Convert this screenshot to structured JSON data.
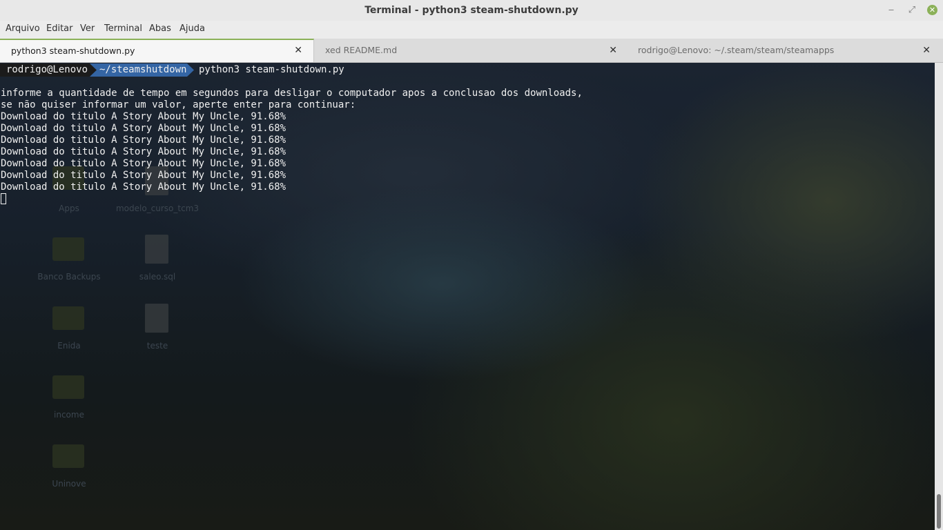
{
  "window": {
    "title": "Terminal - python3 steam-shutdown.py",
    "minimize_glyph": "‒",
    "maximize_glyph": "⤢",
    "close_glyph": "✕"
  },
  "menu": {
    "items": [
      "Arquivo",
      "Editar",
      "Ver",
      "Terminal",
      "Abas",
      "Ajuda"
    ]
  },
  "tabs": [
    {
      "label": "python3 steam-shutdown.py",
      "close": "✕"
    },
    {
      "label": "xed README.md",
      "close": "✕"
    },
    {
      "label": "rodrigo@Lenovo: ~/.steam/steam/steamapps",
      "close": "✕"
    }
  ],
  "prompt": {
    "user_host": "rodrigo@Lenovo",
    "path": "~/steamshutdown",
    "command": "python3 steam-shutdown.py"
  },
  "output": [
    "informe a quantidade de tempo em segundos para desligar o computador apos a conclusao dos downloads,",
    "se não quiser informar um valor, aperte enter para continuar:",
    "Download do titulo A Story About My Uncle, 91.68%",
    "Download do titulo A Story About My Uncle, 91.68%",
    "Download do titulo A Story About My Uncle, 91.68%",
    "Download do titulo A Story About My Uncle, 91.68%",
    "Download do titulo A Story About My Uncle, 91.68%",
    "Download do titulo A Story About My Uncle, 91.68%",
    "Download do titulo A Story About My Uncle, 91.68%"
  ],
  "desktop": {
    "icons": [
      "Apps",
      "modelo_curso_tcm3",
      "Banco Backups",
      "saleo.sql",
      "Enida",
      "teste",
      "income",
      "Uninove"
    ]
  },
  "colors": {
    "accent": "#8bb158",
    "prompt_user_bg": "#1b1b1b",
    "prompt_path_bg": "#3465a4",
    "terminal_fg": "#f0f0f0"
  }
}
